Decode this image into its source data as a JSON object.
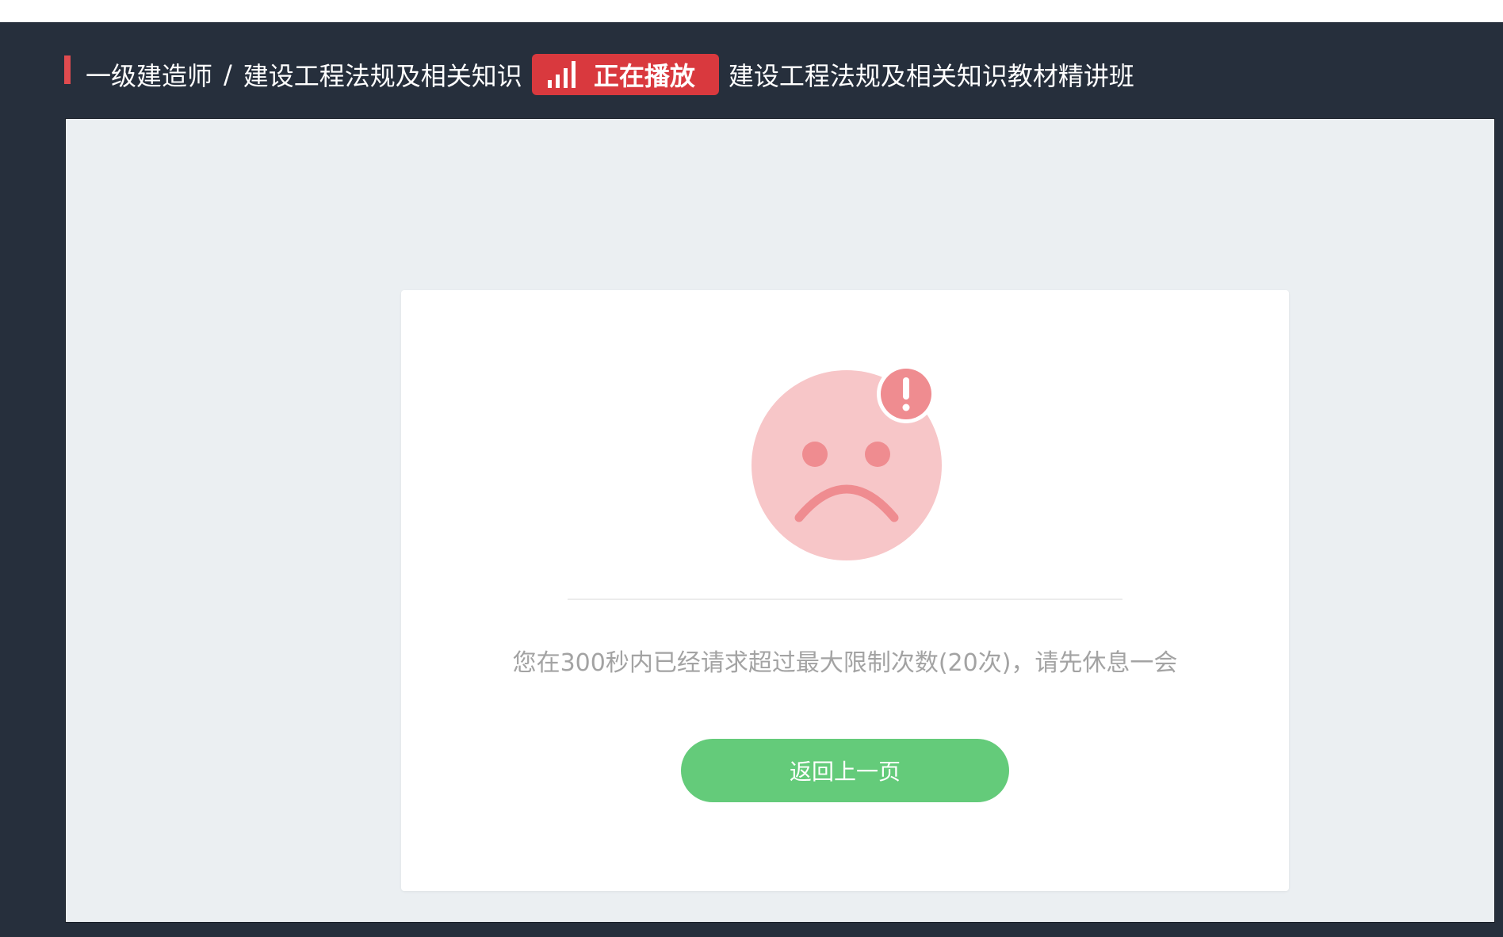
{
  "header": {
    "breadcrumb": {
      "category": "一级建造师",
      "separator": "/",
      "subject": "建设工程法规及相关知识"
    },
    "playing_badge": {
      "icon": "signal-bars-icon",
      "label": "正在播放"
    },
    "course_title": "建设工程法规及相关知识教材精讲班"
  },
  "error_card": {
    "illustration": "sad-face-with-exclamation-icon",
    "message": "您在300秒内已经请求超过最大限制次数(20次)，请先休息一会",
    "back_button_label": "返回上一页"
  },
  "colors": {
    "frame_background": "#262f3c",
    "accent_red": "#d9393e",
    "panel_background": "#ebeff2",
    "face_fill": "#f7c6c8",
    "face_features": "#ef8c90",
    "button_green": "#64cb7a",
    "message_gray": "#a3a3a3"
  }
}
